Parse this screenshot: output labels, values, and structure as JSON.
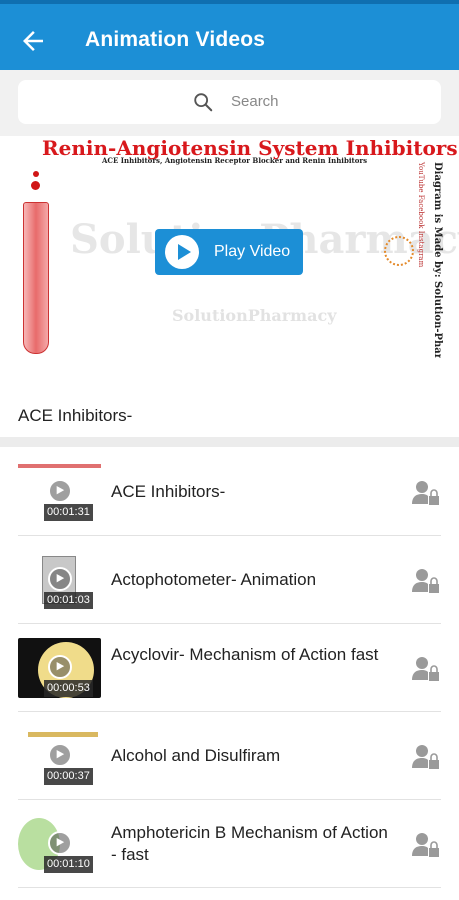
{
  "header": {
    "title": "Animation Videos",
    "back_icon": "arrow-left-icon"
  },
  "search": {
    "placeholder": "Search",
    "icon": "search-icon"
  },
  "hero": {
    "slide_title": "Renin-Angiotensin System Inhibitors",
    "slide_subtitle": "ACE Inhibitors, Angiotensin Receptor Blocker and Renin Inhibitors",
    "watermark": "SolutionPharmacy",
    "side_text": "Diagram is Made by: Solution-Pharmacy",
    "side_small": "YouTube Facebook Instagram",
    "play_label": "Play Video",
    "caption": "ACE Inhibitors-"
  },
  "videos": [
    {
      "title": "ACE Inhibitors-",
      "duration": "00:01:31",
      "locked": true
    },
    {
      "title": "Actophotometer- Animation",
      "duration": "00:01:03",
      "locked": true
    },
    {
      "title": "Acyclovir- Mechanism of Action fast",
      "duration": "00:00:53",
      "locked": true
    },
    {
      "title": "Alcohol and Disulfiram",
      "duration": "00:00:37",
      "locked": true
    },
    {
      "title": "Amphotericin B Mechanism of Action - fast",
      "duration": "00:01:10",
      "locked": true
    }
  ],
  "colors": {
    "primary": "#1c8fd6",
    "title_red": "#d8181c"
  }
}
